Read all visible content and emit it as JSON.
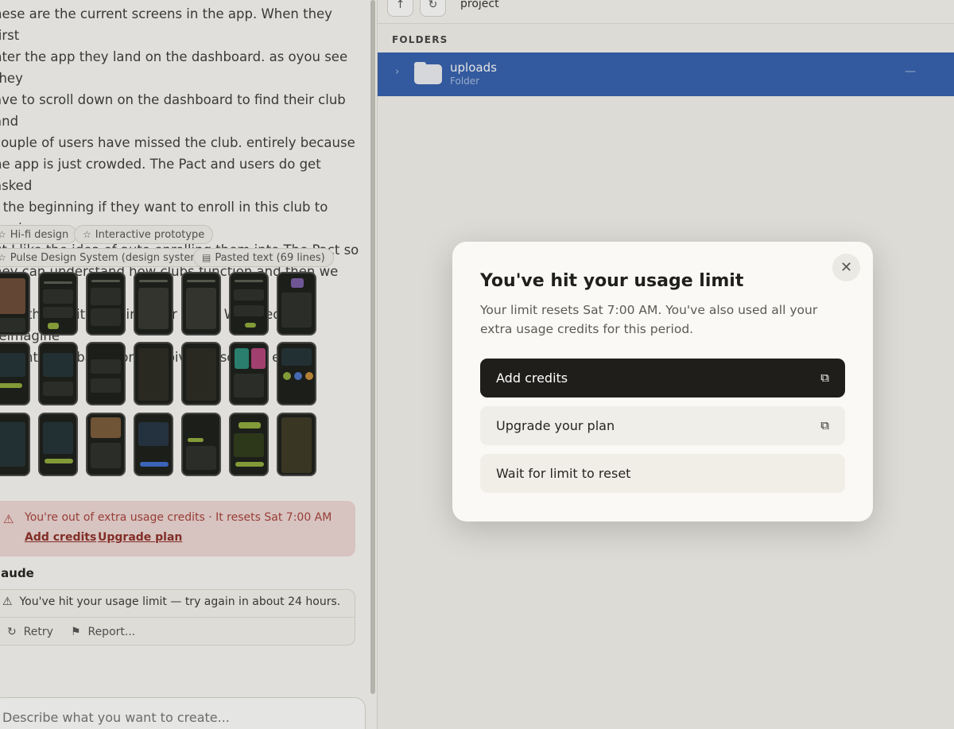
{
  "chat": {
    "message": "hese are the current screens in the app. When they first\nnter the app they land on the dashboard. as oyou see they\nave to scroll down on the dashboard to find their club and\n couple of users have missed the club. entirely because\nhe app is just crowded.  The Pact and users do get asked\nt the beginning if they want to enroll in this club to begin\nut I like the idea of auto enrolling them into The Pact so\nhey can understand how clubs function and then we give\nhem the ability to join other clubs. We need to reimagine\nhis entire Ui based on the pivot described earlier",
    "chips": [
      {
        "icon": "star-icon",
        "label": "Hi-fi design"
      },
      {
        "icon": "star-icon",
        "label": "Interactive prototype"
      },
      {
        "icon": "star-icon",
        "label": "Pulse Design System (design system)"
      },
      {
        "icon": "document-icon",
        "label": "Pasted text (69 lines)"
      }
    ],
    "warning": {
      "text": "You're out of extra usage credits · It resets Sat 7:00 AM",
      "add_credits": "Add credits",
      "upgrade_plan": "Upgrade plan"
    },
    "assistant_label": "laude",
    "error": {
      "text": "You've hit your usage limit — try again in about 24 hours.",
      "retry": "Retry",
      "report": "Report..."
    },
    "composer_placeholder": "Describe what you want to create..."
  },
  "files": {
    "path": "project",
    "section_header": "FOLDERS",
    "folders": [
      {
        "name": "uploads",
        "type": "Folder",
        "trailing": "—"
      }
    ]
  },
  "modal": {
    "title": "You've hit your usage limit",
    "description": "Your limit resets Sat 7:00 AM. You've also used all your extra usage credits for this period.",
    "buttons": {
      "add_credits": "Add credits",
      "upgrade": "Upgrade your plan",
      "wait": "Wait for limit to reset"
    }
  },
  "colors": {
    "accent_blue": "#3561b0",
    "primary_button": "#1f1e1b",
    "warning_bg": "#f0d9d6",
    "warning_text": "#a8413a"
  }
}
